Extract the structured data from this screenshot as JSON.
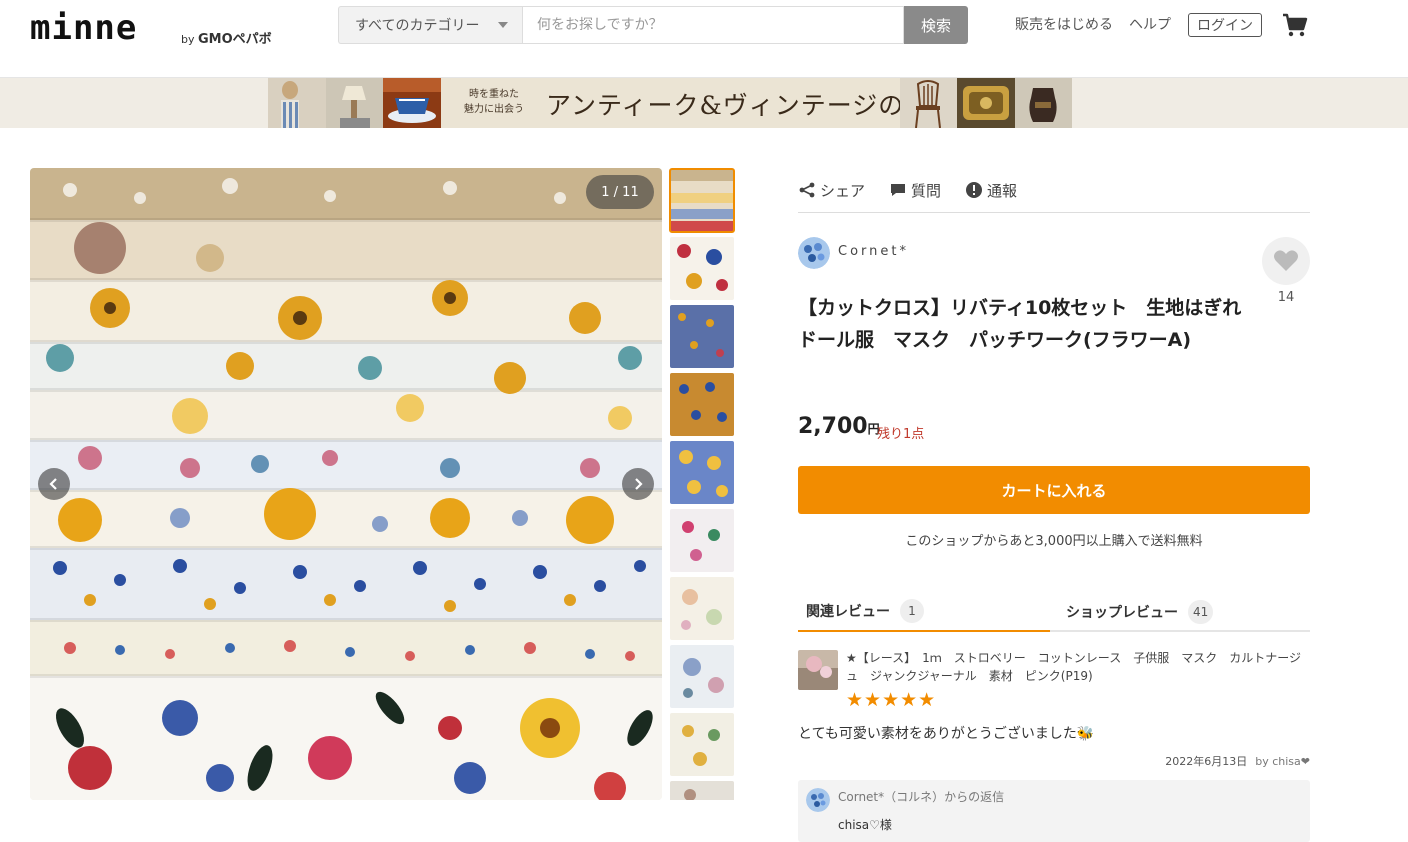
{
  "header": {
    "logo_text": "minne",
    "logo_by": "by",
    "logo_company": "GMOペパボ",
    "category_select": "すべてのカテゴリー",
    "search_placeholder": "何をお探しですか？",
    "search_button": "検索",
    "nav": {
      "sell": "販売をはじめる",
      "help": "ヘルプ",
      "login": "ログイン"
    }
  },
  "banner": {
    "sub_line1": "時を重ねた",
    "sub_line2": "魅力に出会う",
    "title": "アンティーク&ヴィンテージの世界"
  },
  "gallery": {
    "counter": "1 / 11",
    "thumbnail_count": 9
  },
  "product": {
    "actions": {
      "share": "シェア",
      "question": "質問",
      "report": "通報"
    },
    "shop_name": "Cornet*",
    "favorite_count": "14",
    "title": "【カットクロス】リバティ10枚セット　生地はぎれ　ドール服　マスク　パッチワーク(フラワーA)",
    "price": "2,700",
    "price_unit": "円",
    "stock": "残り1点",
    "cart_button": "カートに入れる",
    "shipping_note": "このショップからあと3,000円以上購入で送料無料"
  },
  "reviews": {
    "tabs": [
      {
        "label": "関連レビュー",
        "count": "1"
      },
      {
        "label": "ショップレビュー",
        "count": "41"
      }
    ],
    "item_title": "★【レース】　1ｍ　ストロベリー　コットンレース　子供服　マスク　カルトナージュ　ジャンクジャーナル　素材　ピンク(P19)",
    "stars": "★★★★★",
    "rating": 5,
    "comment": "とても可愛い素材をありがとうございました🐝",
    "date": "2022年6月13日",
    "by": "by chisa❤",
    "reply_from": "Cornet*（コルネ）からの返信",
    "reply_text": "chisa♡様"
  },
  "colors": {
    "accent": "#f28c00",
    "stock": "#c0392b",
    "search_button": "#8a8a8a"
  },
  "icons": [
    "share-icon",
    "chat-bubble-icon",
    "exclamation-circle-icon",
    "heart-icon",
    "cart-icon",
    "chevron-left-icon",
    "chevron-right-icon",
    "chevron-down-icon"
  ]
}
